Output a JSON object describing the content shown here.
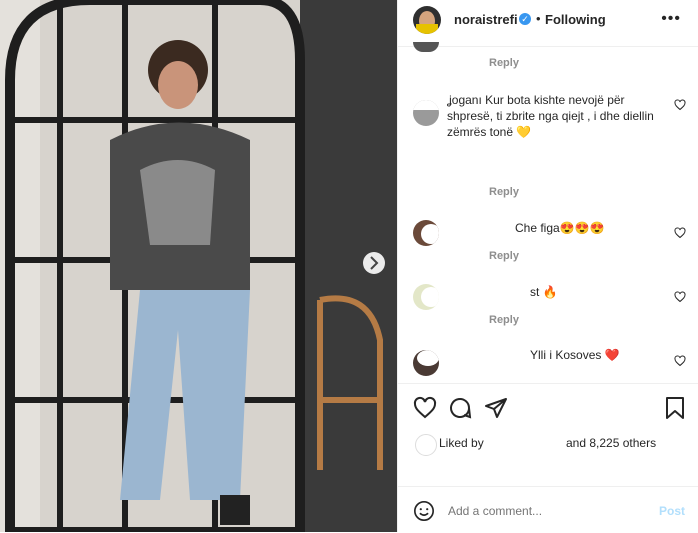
{
  "post": {
    "username": "noraistrefi",
    "follow_status": "Following",
    "dot_separator": "•",
    "more_label": "•••"
  },
  "comments": [
    {
      "reply_label": "Reply"
    },
    {
      "text": "ʝoganı Kur bota kishte nevojë për shpresë, ti zbrite nga qiejt , i dhe diellin zëmrës tonë 💛",
      "reply_label": "Reply"
    },
    {
      "text": "Che figa😍😍😍",
      "reply_label": "Reply"
    },
    {
      "text": "st 🔥",
      "reply_label": "Reply"
    },
    {
      "text": "Ylli i Kosoves ❤️"
    }
  ],
  "likes": {
    "liked_by_label": "Liked by",
    "others_label": "and 8,225 others"
  },
  "composer": {
    "placeholder": "Add a comment...",
    "post_label": "Post"
  },
  "colors": {
    "link_blue": "#0095f6",
    "verified_blue": "#3897f0",
    "secondary_text": "#8e8e8e",
    "primary_text": "#262626"
  }
}
